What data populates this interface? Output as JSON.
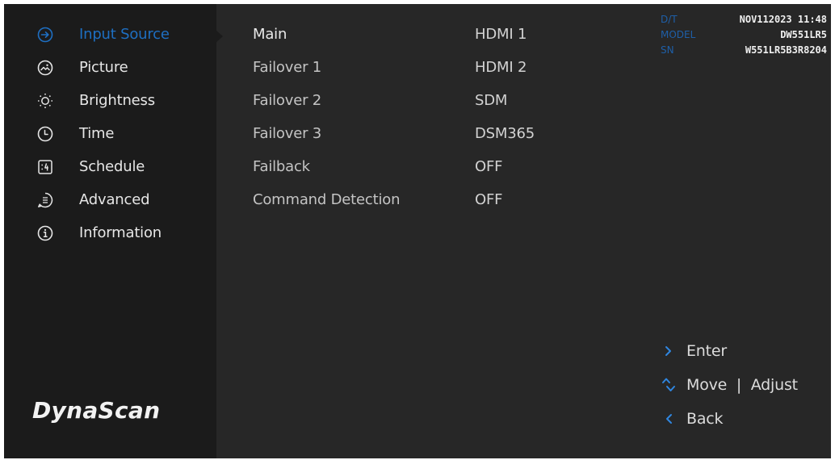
{
  "sidebar": {
    "items": [
      {
        "label": "Input Source",
        "icon": "input-source-icon",
        "active": true
      },
      {
        "label": "Picture",
        "icon": "picture-icon",
        "active": false
      },
      {
        "label": "Brightness",
        "icon": "brightness-icon",
        "active": false
      },
      {
        "label": "Time",
        "icon": "clock-icon",
        "active": false
      },
      {
        "label": "Schedule",
        "icon": "schedule-icon",
        "active": false
      },
      {
        "label": "Advanced",
        "icon": "advanced-icon",
        "active": false
      },
      {
        "label": "Information",
        "icon": "info-icon",
        "active": false
      }
    ],
    "logo": "DynaScan"
  },
  "settings": {
    "rows": [
      {
        "label": "Main",
        "value": "HDMI 1"
      },
      {
        "label": "Failover 1",
        "value": "HDMI 2"
      },
      {
        "label": "Failover 2",
        "value": "SDM"
      },
      {
        "label": "Failover 3",
        "value": "DSM365"
      },
      {
        "label": "Failback",
        "value": "OFF"
      },
      {
        "label": "Command Detection",
        "value": "OFF"
      }
    ]
  },
  "device_info": {
    "dt_label": "D/T",
    "dt_value": "NOV112023 11:48",
    "model_label": "MODEL",
    "model_value": "DW551LR5",
    "sn_label": "SN",
    "sn_value": "W551LR5B3R8204"
  },
  "hints": {
    "enter_icon": ">",
    "enter": "Enter",
    "move_adjust": "Move  |  Adjust",
    "back_icon": "<",
    "back": "Back"
  },
  "colors": {
    "accent": "#1e6fc2",
    "info_key": "#1e5fa8",
    "sidebar_bg": "#1b1b1b",
    "panel_bg": "#272727"
  }
}
